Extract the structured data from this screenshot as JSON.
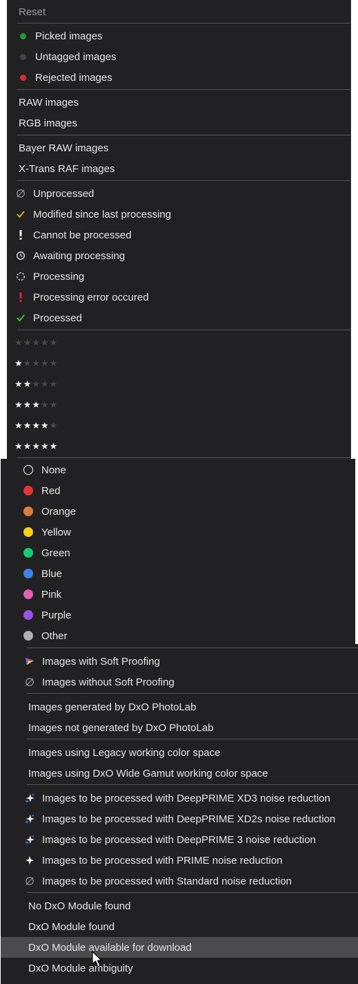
{
  "filter_menu": {
    "reset": "Reset",
    "tags": [
      {
        "label": "Picked images",
        "color": "#1e9b3a"
      },
      {
        "label": "Untagged images",
        "color": "#444447"
      },
      {
        "label": "Rejected images",
        "color": "#e02a2a"
      }
    ],
    "file_types": [
      "RAW images",
      "RGB images"
    ],
    "sensor_types": [
      "Bayer RAW images",
      "X-Trans RAF images"
    ],
    "processing_status": [
      {
        "label": "Unprocessed",
        "icon": "empty-set-icon"
      },
      {
        "label": "Modified since last processing",
        "icon": "checkmark-yellow-icon"
      },
      {
        "label": "Cannot be processed",
        "icon": "exclamation-white-icon"
      },
      {
        "label": "Awaiting processing",
        "icon": "clock-icon"
      },
      {
        "label": "Processing",
        "icon": "spinner-icon"
      },
      {
        "label": "Processing error occured",
        "icon": "exclamation-red-icon"
      },
      {
        "label": "Processed",
        "icon": "checkmark-green-icon"
      }
    ],
    "ratings": [
      0,
      1,
      2,
      3,
      4,
      5
    ],
    "color_labels": [
      {
        "label": "None",
        "color": "none"
      },
      {
        "label": "Red",
        "color": "#e43434"
      },
      {
        "label": "Orange",
        "color": "#dc7c3c"
      },
      {
        "label": "Yellow",
        "color": "#f6d013"
      },
      {
        "label": "Green",
        "color": "#16cc74"
      },
      {
        "label": "Blue",
        "color": "#3c84ec"
      },
      {
        "label": "Pink",
        "color": "#e060b4"
      },
      {
        "label": "Purple",
        "color": "#9a52e4"
      },
      {
        "label": "Other",
        "color": "#b0b0b0"
      }
    ],
    "soft_proofing": [
      {
        "label": "Images with Soft Proofing",
        "icon": "gamut-triangle-icon"
      },
      {
        "label": "Images without Soft Proofing",
        "icon": "empty-set-icon"
      }
    ],
    "generated": [
      "Images generated by DxO PhotoLab",
      "Images not generated by DxO PhotoLab"
    ],
    "color_space": [
      "Images using Legacy working color space",
      "Images using DxO Wide Gamut working color space"
    ],
    "noise_reduction": [
      {
        "label": "Images to be processed with DeepPRIME XD3 noise reduction",
        "icon": "sparkle-color-icon"
      },
      {
        "label": "Images to be processed with DeepPRIME XD2s noise reduction",
        "icon": "sparkle-color-icon"
      },
      {
        "label": "Images to be processed with DeepPRIME 3 noise reduction",
        "icon": "sparkle-color-icon"
      },
      {
        "label": "Images to be processed with PRIME noise reduction",
        "icon": "sparkle-white-icon"
      },
      {
        "label": "Images to be processed with Standard noise reduction",
        "icon": "empty-set-icon"
      }
    ],
    "modules": [
      "No DxO Module found",
      "DxO Module found",
      "DxO Module available for download",
      "DxO Module ambiguity"
    ],
    "hovered_item": "DxO Module available for download"
  }
}
